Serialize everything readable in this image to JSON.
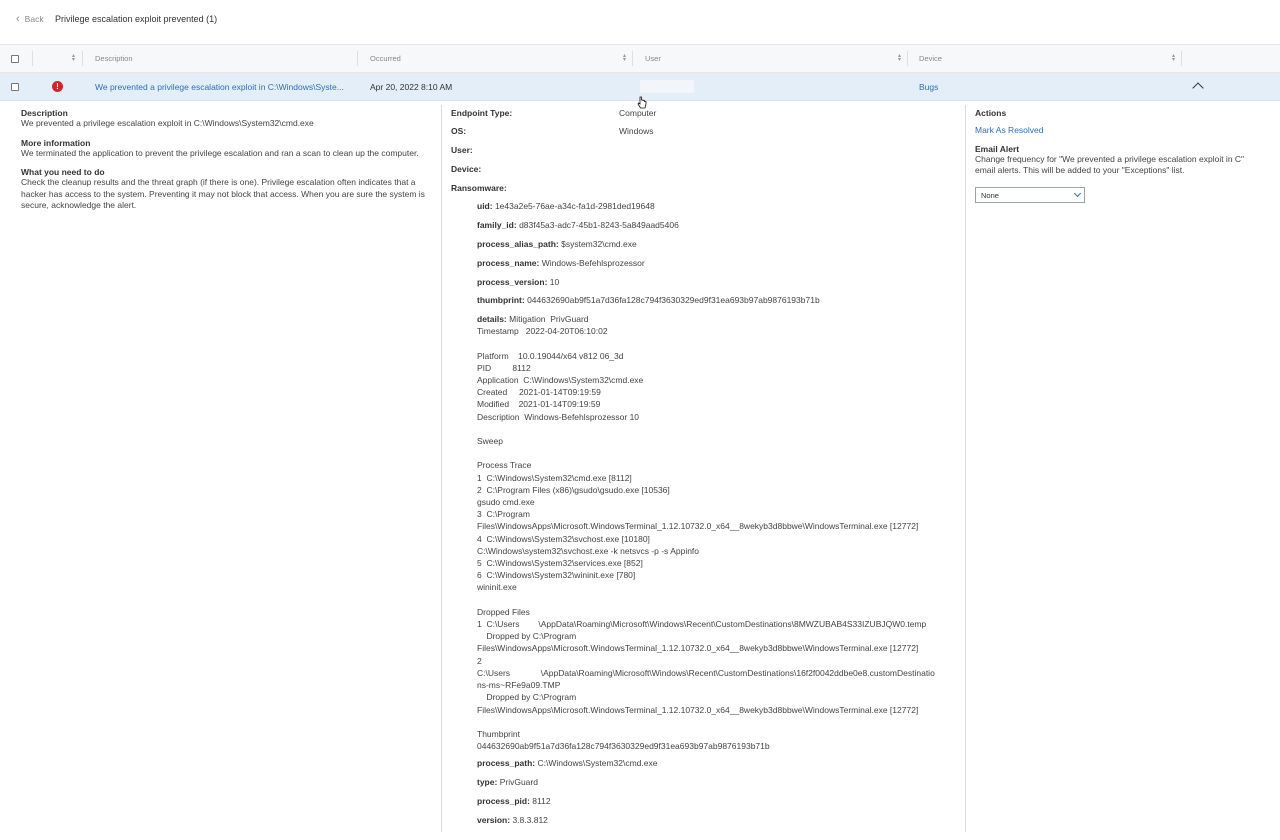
{
  "header": {
    "back_label": "Back",
    "title": "Privilege escalation exploit prevented (1)"
  },
  "table": {
    "columns": [
      "Description",
      "Occurred",
      "User",
      "Device"
    ],
    "row": {
      "description": "We prevented a privilege escalation exploit in C:\\Windows\\Syste...",
      "occurred": "Apr 20, 2022 8:10 AM",
      "user": "",
      "device": "Bugs"
    }
  },
  "left": {
    "description_label": "Description",
    "description": "We prevented a privilege escalation exploit in C:\\Windows\\System32\\cmd.exe",
    "more_label": "More information",
    "more": "We terminated the application to prevent the privilege escalation and ran a scan to clean up the computer.",
    "todo_label": "What you need to do",
    "todo": "Check the cleanup results and the threat graph (if there is one). Privilege escalation often indicates that a hacker has access to the system. Preventing it may not block that access. When you are sure the system is secure, acknowledge the alert."
  },
  "middle": {
    "endpoint_type_label": "Endpoint Type:",
    "endpoint_type": "Computer",
    "os_label": "OS:",
    "os": "Windows",
    "user_label": "User:",
    "device_label": "Device:",
    "ransomware_label": "Ransomware:",
    "fields": [
      {
        "k": "uid:",
        "v": "1e43a2e5-76ae-a34c-fa1d-2981ded19648"
      },
      {
        "k": "family_id:",
        "v": "d83f45a3-adc7-45b1-8243-5a849aad5406"
      },
      {
        "k": "process_alias_path:",
        "v": "$system32\\cmd.exe"
      },
      {
        "k": "process_name:",
        "v": "Windows-Befehlsprozessor"
      },
      {
        "k": "process_version:",
        "v": "10"
      },
      {
        "k": "thumbprint:",
        "v": "044632690ab9f51a7d36fa128c794f3630329ed9f31ea693b97ab9876193b71b"
      }
    ],
    "details_label": "details:",
    "details_text": "Mitigation  PrivGuard\nTimestamp   2022-04-20T06:10:02\n\nPlatform    10.0.19044/x64 v812 06_3d\nPID         8112\nApplication  C:\\Windows\\System32\\cmd.exe\nCreated     2021-01-14T09:19:59\nModified    2021-01-14T09:19:59\nDescription  Windows-Befehlsprozessor 10\n\nSweep\n\nProcess Trace\n1  C:\\Windows\\System32\\cmd.exe [8112]\n2  C:\\Program Files (x86)\\gsudo\\gsudo.exe [10536]\ngsudo cmd.exe\n3  C:\\Program\nFiles\\WindowsApps\\Microsoft.WindowsTerminal_1.12.10732.0_x64__8wekyb3d8bbwe\\WindowsTerminal.exe [12772]\n4  C:\\Windows\\System32\\svchost.exe [10180]\nC:\\Windows\\system32\\svchost.exe -k netsvcs -p -s Appinfo\n5  C:\\Windows\\System32\\services.exe [852]\n6  C:\\Windows\\System32\\wininit.exe [780]\nwininit.exe\n\nDropped Files\n1  C:\\Users        \\AppData\\Roaming\\Microsoft\\Windows\\Recent\\CustomDestinations\\8MWZUBAB4S33IZUBJQW0.temp\n    Dropped by C:\\Program\nFiles\\WindowsApps\\Microsoft.WindowsTerminal_1.12.10732.0_x64__8wekyb3d8bbwe\\WindowsTerminal.exe [12772]\n2\nC:\\Users             \\AppData\\Roaming\\Microsoft\\Windows\\Recent\\CustomDestinations\\16f2f0042ddbe0e8.customDestinatio\nns-ms~RFe9a09.TMP\n    Dropped by C:\\Program\nFiles\\WindowsApps\\Microsoft.WindowsTerminal_1.12.10732.0_x64__8wekyb3d8bbwe\\WindowsTerminal.exe [12772]\n\nThumbprint\n044632690ab9f51a7d36fa128c794f3630329ed9f31ea693b97ab9876193b71b",
    "tail": [
      {
        "k": "process_path:",
        "v": "C:\\Windows\\System32\\cmd.exe"
      },
      {
        "k": "type:",
        "v": "PrivGuard"
      },
      {
        "k": "process_pid:",
        "v": "8112"
      },
      {
        "k": "version:",
        "v": "3.8.3.812"
      }
    ]
  },
  "right": {
    "actions_label": "Actions",
    "resolve_label": "Mark As Resolved",
    "email_label": "Email Alert",
    "email_text": "Change frequency for \"We prevented a privilege escalation exploit in C\" email alerts. This will be added to your \"Exceptions\" list.",
    "frequency_value": "None"
  },
  "colors": {
    "accent": "#2f6eb3",
    "row_selected": "#e3eef8",
    "error": "#d3232b"
  }
}
